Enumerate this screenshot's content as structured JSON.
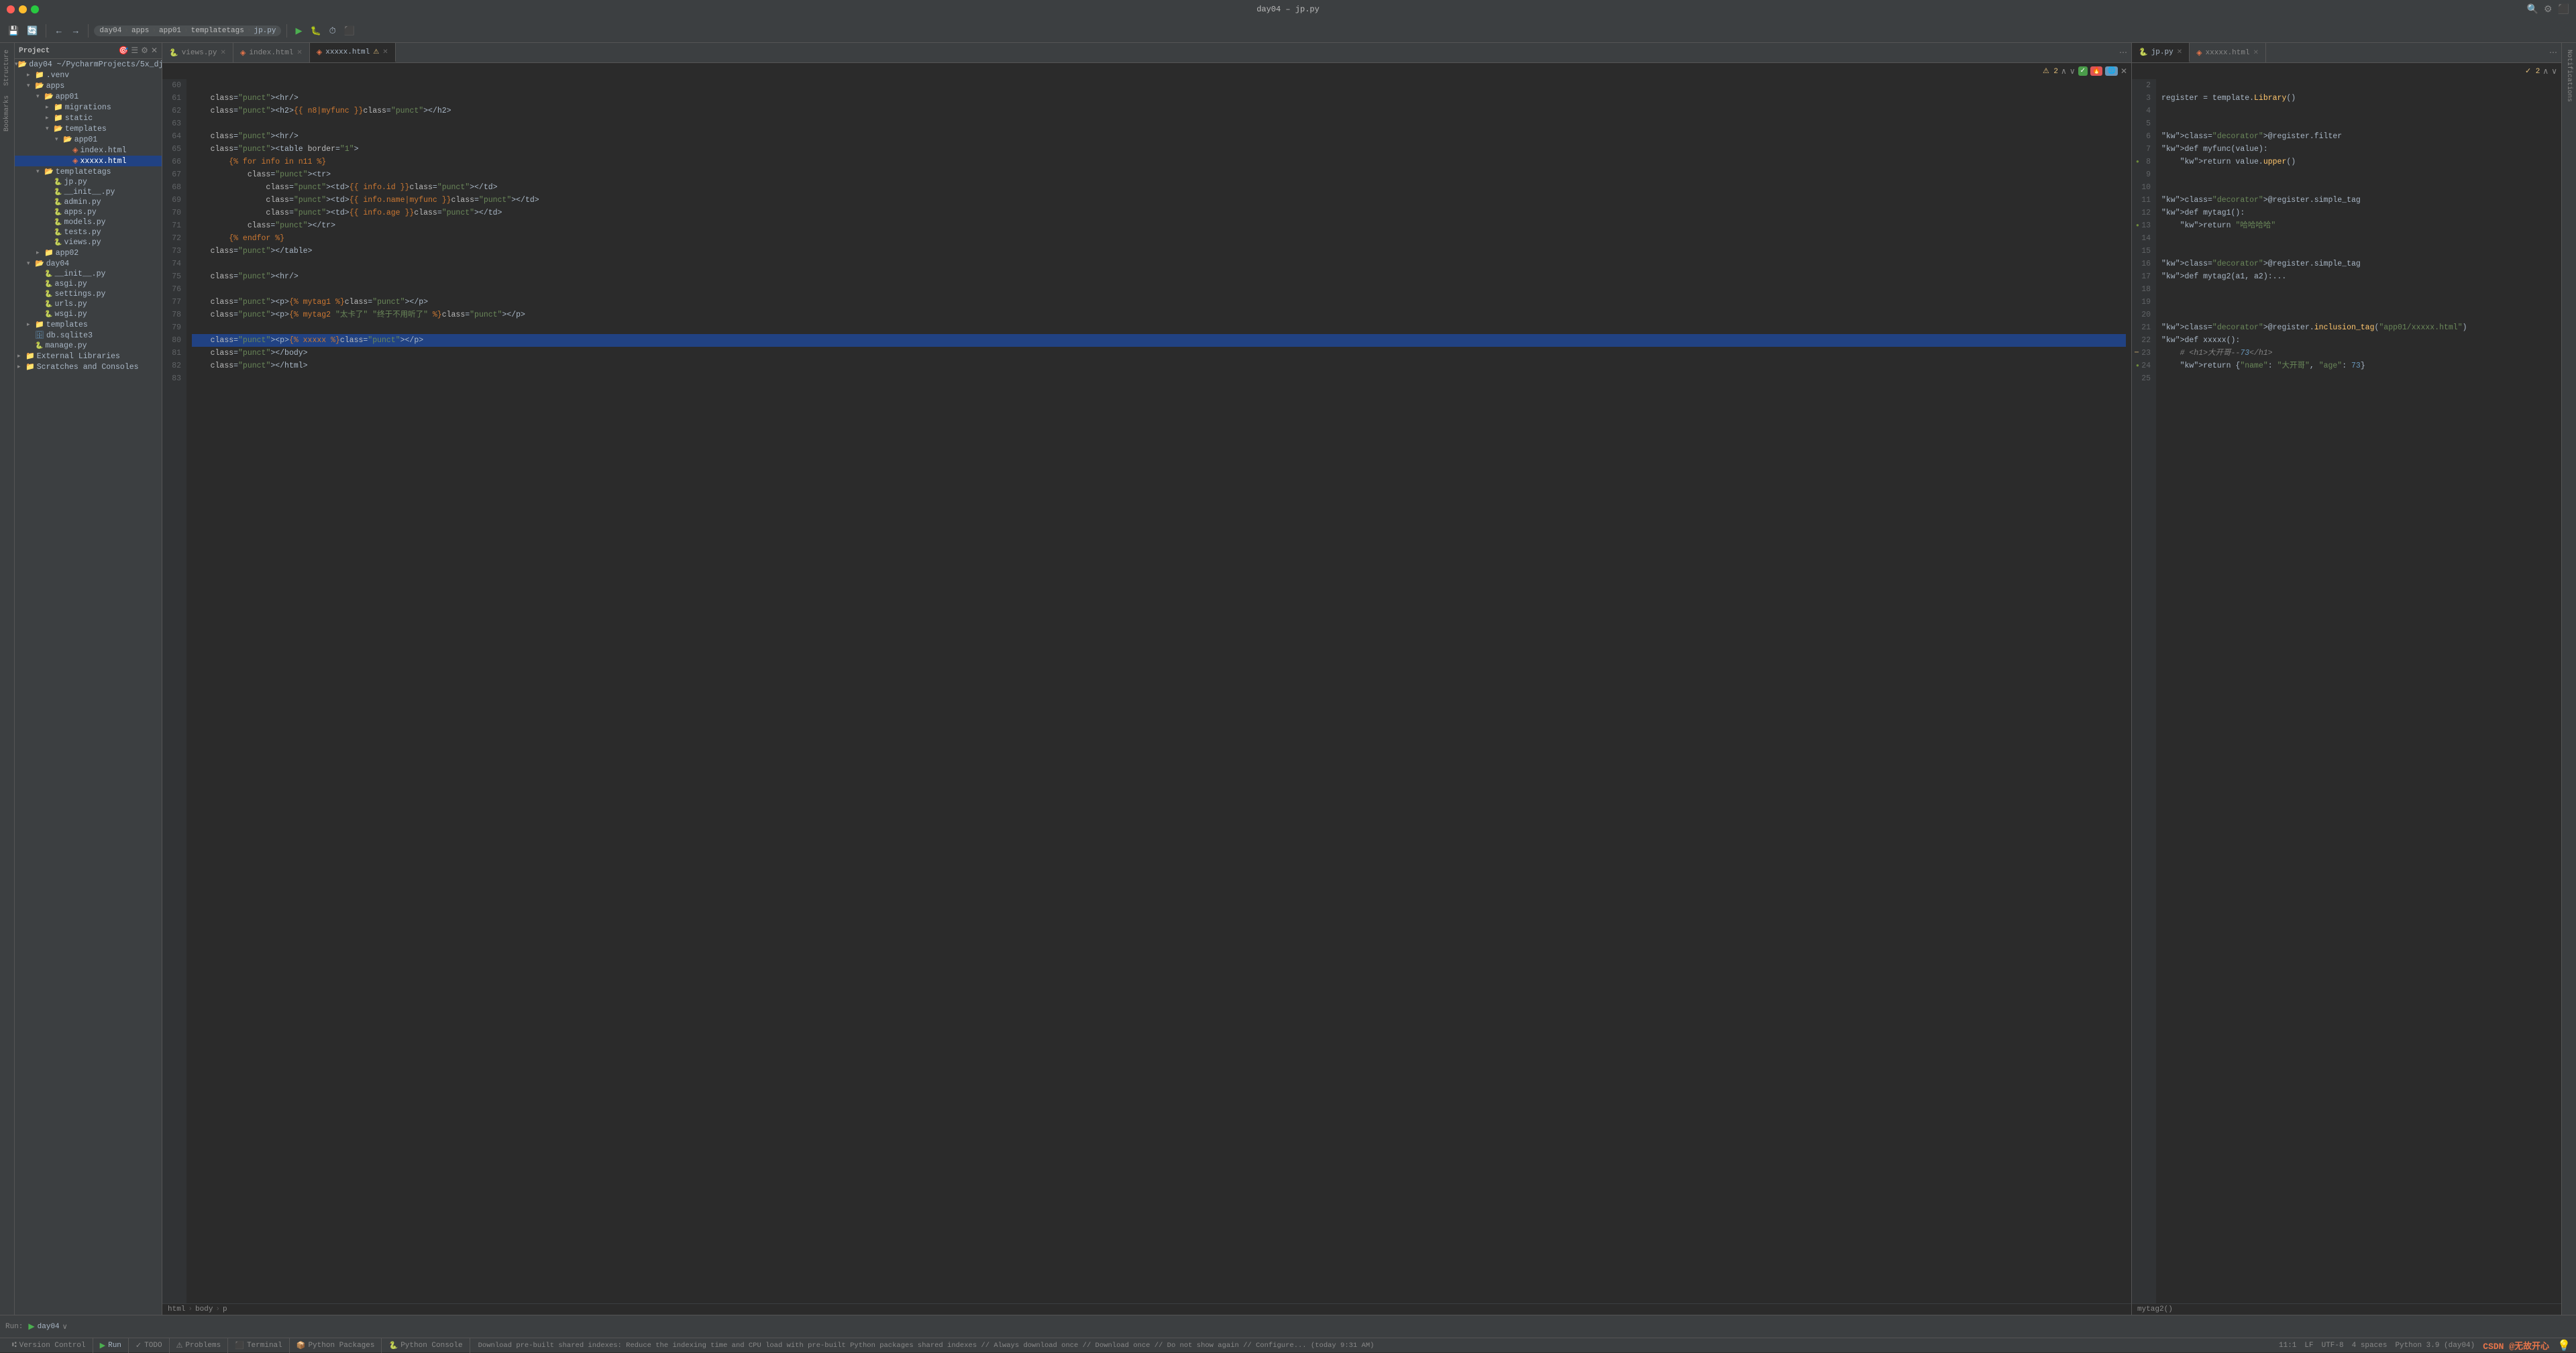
{
  "titleBar": {
    "title": "day04 – jp.py",
    "tabs": [
      "Structure",
      "Bookmarks"
    ]
  },
  "toolbar": {
    "breadcrumbs": [
      "day04",
      "apps",
      "app01",
      "templatetags",
      "jp.py"
    ],
    "activeFile": "jp.py"
  },
  "tabs": {
    "leftEditor": {
      "tabs": [
        {
          "label": "views.py",
          "active": false,
          "icon": "🐍"
        },
        {
          "label": "index.html",
          "active": false,
          "icon": "📄"
        },
        {
          "label": "xxxxx.html",
          "active": true,
          "icon": "📄",
          "warning": true
        }
      ]
    },
    "rightEditor": {
      "tabs": [
        {
          "label": "jp.py",
          "active": true,
          "icon": "🐍"
        },
        {
          "label": "xxxxx.html",
          "active": false,
          "icon": "📄"
        }
      ]
    }
  },
  "leftCode": {
    "startLine": 60,
    "lines": [
      {
        "n": 60,
        "text": ""
      },
      {
        "n": 61,
        "text": "    <hr/>"
      },
      {
        "n": 62,
        "text": "    <h2>{{ n8|myfunc }}</h2>"
      },
      {
        "n": 63,
        "text": ""
      },
      {
        "n": 64,
        "text": "    <hr/>"
      },
      {
        "n": 65,
        "text": "    <table border=\"1\">"
      },
      {
        "n": 66,
        "text": "        {% for info in n11 %}"
      },
      {
        "n": 67,
        "text": "            <tr>"
      },
      {
        "n": 68,
        "text": "                <td>{{ info.id }}</td>"
      },
      {
        "n": 69,
        "text": "                <td>{{ info.name|myfunc }}</td>"
      },
      {
        "n": 70,
        "text": "                <td>{{ info.age }}</td>"
      },
      {
        "n": 71,
        "text": "            </tr>"
      },
      {
        "n": 72,
        "text": "        {% endfor %}"
      },
      {
        "n": 73,
        "text": "    </table>"
      },
      {
        "n": 74,
        "text": ""
      },
      {
        "n": 75,
        "text": "    <hr/>"
      },
      {
        "n": 76,
        "text": ""
      },
      {
        "n": 77,
        "text": "    <p>{% mytag1 %}</p>"
      },
      {
        "n": 78,
        "text": "    <p>{% mytag2 \"太卡了\" \"终于不用听了\" %}</p>"
      },
      {
        "n": 79,
        "text": ""
      },
      {
        "n": 80,
        "text": "    <p>{% xxxxx %}</p>",
        "selected": true
      },
      {
        "n": 81,
        "text": "    </body>"
      },
      {
        "n": 82,
        "text": "    </html>"
      },
      {
        "n": 83,
        "text": ""
      }
    ],
    "breadcrumb": [
      "html",
      "body",
      "p"
    ]
  },
  "rightCode": {
    "startLine": 2,
    "lines": [
      {
        "n": 2,
        "text": ""
      },
      {
        "n": 3,
        "text": "register = template.Library()"
      },
      {
        "n": 4,
        "text": ""
      },
      {
        "n": 5,
        "text": ""
      },
      {
        "n": 6,
        "text": "@register.filter"
      },
      {
        "n": 7,
        "text": "def myfunc(value):"
      },
      {
        "n": 8,
        "text": "    return value.upper()",
        "gutter": true
      },
      {
        "n": 9,
        "text": ""
      },
      {
        "n": 10,
        "text": ""
      },
      {
        "n": 11,
        "text": "@register.simple_tag"
      },
      {
        "n": 12,
        "text": "def mytag1():"
      },
      {
        "n": 13,
        "text": "    return \"哈哈哈哈\"",
        "gutter": true
      },
      {
        "n": 14,
        "text": ""
      },
      {
        "n": 15,
        "text": ""
      },
      {
        "n": 16,
        "text": "@register.simple_tag"
      },
      {
        "n": 17,
        "text": "def mytag2(a1, a2):..."
      },
      {
        "n": 18,
        "text": ""
      },
      {
        "n": 19,
        "text": ""
      },
      {
        "n": 20,
        "text": ""
      },
      {
        "n": 21,
        "text": "@register.inclusion_tag(\"app01/xxxxx.html\")",
        "gutter2": true
      },
      {
        "n": 22,
        "text": "def xxxxx():"
      },
      {
        "n": 23,
        "text": "    # <h1>大开哥--73</h1>",
        "warning": true
      },
      {
        "n": 24,
        "text": "    return {\"name\": \"大开哥\", \"age\": 73}",
        "gutter": true
      },
      {
        "n": 25,
        "text": ""
      }
    ],
    "breadcrumb": "mytag2()"
  },
  "sidebar": {
    "title": "Project",
    "tree": [
      {
        "level": 0,
        "label": "day04  ~/PycharmProjects/5x_dj",
        "type": "folder",
        "open": true
      },
      {
        "level": 1,
        "label": ".venv",
        "type": "folder",
        "open": false
      },
      {
        "level": 1,
        "label": "apps",
        "type": "folder",
        "open": true
      },
      {
        "level": 2,
        "label": "app01",
        "type": "folder",
        "open": true
      },
      {
        "level": 3,
        "label": "migrations",
        "type": "folder",
        "open": false
      },
      {
        "level": 3,
        "label": "static",
        "type": "folder",
        "open": false
      },
      {
        "level": 3,
        "label": "templates",
        "type": "folder",
        "open": true
      },
      {
        "level": 4,
        "label": "app01",
        "type": "folder",
        "open": true
      },
      {
        "level": 5,
        "label": "index.html",
        "type": "html"
      },
      {
        "level": 5,
        "label": "xxxxx.html",
        "type": "html",
        "selected": true
      },
      {
        "level": 2,
        "label": "templatetags",
        "type": "folder",
        "open": true
      },
      {
        "level": 3,
        "label": "jp.py",
        "type": "py"
      },
      {
        "level": 3,
        "label": "__init__.py",
        "type": "py"
      },
      {
        "level": 3,
        "label": "admin.py",
        "type": "py"
      },
      {
        "level": 3,
        "label": "apps.py",
        "type": "py"
      },
      {
        "level": 3,
        "label": "models.py",
        "type": "py"
      },
      {
        "level": 3,
        "label": "tests.py",
        "type": "py"
      },
      {
        "level": 3,
        "label": "views.py",
        "type": "py"
      },
      {
        "level": 2,
        "label": "app02",
        "type": "folder",
        "open": false
      },
      {
        "level": 1,
        "label": "day04",
        "type": "folder",
        "open": true
      },
      {
        "level": 2,
        "label": "__init__.py",
        "type": "py"
      },
      {
        "level": 2,
        "label": "asgi.py",
        "type": "py"
      },
      {
        "level": 2,
        "label": "settings.py",
        "type": "py"
      },
      {
        "level": 2,
        "label": "urls.py",
        "type": "py"
      },
      {
        "level": 2,
        "label": "wsgi.py",
        "type": "py"
      },
      {
        "level": 1,
        "label": "templates",
        "type": "folder",
        "open": false
      },
      {
        "level": 1,
        "label": "db.sqlite3",
        "type": "db"
      },
      {
        "level": 1,
        "label": "manage.py",
        "type": "py"
      },
      {
        "level": 0,
        "label": "External Libraries",
        "type": "folder",
        "open": false
      },
      {
        "level": 0,
        "label": "Scratches and Consoles",
        "type": "folder",
        "open": false
      }
    ]
  },
  "bottomBar": {
    "runLabel": "Run:",
    "runTarget": "day04",
    "tabs": [
      {
        "label": "Version Control",
        "icon": "⑆"
      },
      {
        "label": "Run",
        "icon": "▶",
        "active": true
      },
      {
        "label": "TODO",
        "icon": "✓"
      },
      {
        "label": "Problems",
        "icon": "⚠"
      },
      {
        "label": "Terminal",
        "icon": "⬛"
      },
      {
        "label": "Python Packages",
        "icon": "📦"
      },
      {
        "label": "Python Console",
        "icon": "🐍"
      }
    ],
    "statusMsg": "Download pre-built shared indexes: Reduce the indexing time and CPU load with pre-built Python packages shared indexes // Always download once // Download once // Do not show again // Configure... (today 9:31 AM)"
  },
  "statusBar": {
    "position": "11:1",
    "lineSep": "LF",
    "encoding": "UTF-8",
    "indent": "4 spaces",
    "fileType": "Python 3.9 (day04)",
    "csdnText": "CSDN @无故开心"
  }
}
